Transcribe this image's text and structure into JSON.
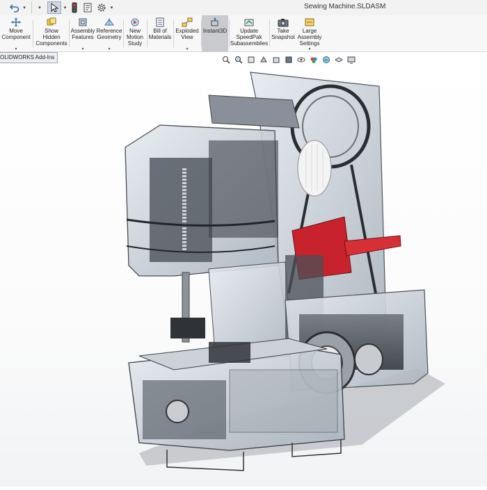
{
  "window": {
    "title": "Sewing Machine.SLDASM"
  },
  "quick_access": [
    {
      "name": "undo-icon"
    },
    {
      "name": "undo-dropdown-icon"
    },
    {
      "name": "select-arrow-icon"
    },
    {
      "name": "select-dropdown-icon"
    },
    {
      "name": "traffic-light-icon"
    },
    {
      "name": "file-properties-icon"
    },
    {
      "name": "options-gear-icon"
    },
    {
      "name": "options-dropdown-icon"
    }
  ],
  "ribbon": {
    "buttons": [
      {
        "id": "move-component",
        "label": "Move\nComponent",
        "has_menu": true
      },
      {
        "id": "show-hidden-components",
        "label": "Show\nHidden\nComponents",
        "has_menu": false
      },
      {
        "id": "assembly-features",
        "label": "Assembly\nFeatures",
        "has_menu": true
      },
      {
        "id": "reference-geometry",
        "label": "Reference\nGeometry",
        "has_menu": true
      },
      {
        "id": "new-motion-study",
        "label": "New\nMotion\nStudy",
        "has_menu": false
      },
      {
        "id": "bill-of-materials",
        "label": "Bill of\nMaterials",
        "has_menu": false
      },
      {
        "id": "exploded-view",
        "label": "Exploded\nView",
        "has_menu": true
      },
      {
        "id": "instant3d",
        "label": "Instant3D",
        "has_menu": false,
        "active": true
      },
      {
        "id": "update-speedpak",
        "label": "Update\nSpeedPak\nSubassemblies",
        "has_menu": false
      },
      {
        "id": "take-snapshot",
        "label": "Take\nSnapshot",
        "has_menu": false
      },
      {
        "id": "large-assembly-settings",
        "label": "Large\nAssembly\nSettings",
        "has_menu": true
      }
    ]
  },
  "tabs": {
    "active": "OLIDWORKS Add-Ins"
  },
  "view_toolbar": [
    "zoom-to-fit-icon",
    "zoom-to-area-icon",
    "previous-view-icon",
    "section-view-icon",
    "view-orientation-icon",
    "display-style-icon",
    "hide-show-items-icon",
    "edit-appearance-icon",
    "apply-scene-icon",
    "view-settings-icon",
    "display-monitor-icon"
  ],
  "model": {
    "name": "sewing-machine-assembly",
    "render": "transparent-wireframe"
  }
}
